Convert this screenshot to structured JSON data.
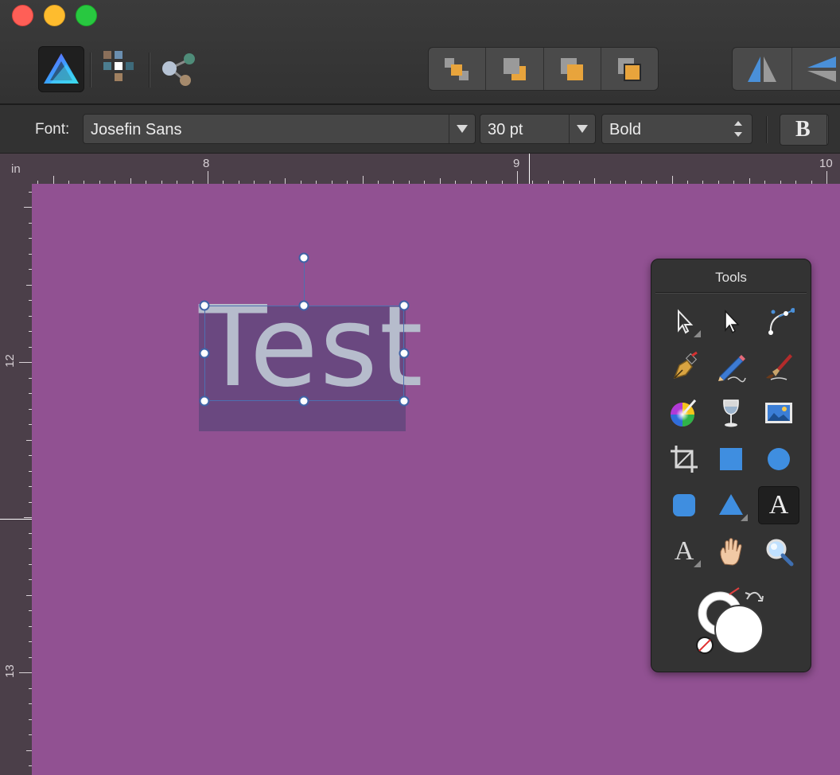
{
  "window": {
    "controls": [
      "close",
      "minimize",
      "zoom"
    ]
  },
  "toolbar": {
    "personas": [
      {
        "name": "photo-persona",
        "icon": "affinity-photo-icon",
        "active": true
      },
      {
        "name": "develop-persona",
        "icon": "develop-grid-icon",
        "active": false
      },
      {
        "name": "export-persona",
        "icon": "export-nodes-icon",
        "active": false
      }
    ],
    "arrange_buttons": [
      "move-to-back-icon",
      "move-back-one-icon",
      "move-forward-one-icon",
      "move-to-front-icon"
    ],
    "flip_buttons": [
      "flip-horizontal-icon",
      "flip-vertical-icon"
    ]
  },
  "context": {
    "font_label": "Font:",
    "font_family": "Josefin Sans",
    "font_size": "30 pt",
    "font_weight": "Bold",
    "bold_label": "B"
  },
  "ruler": {
    "unit": "in",
    "horizontal": [
      "8",
      "9",
      "10"
    ],
    "vertical": [
      "12",
      "13"
    ]
  },
  "canvas": {
    "text": "Test",
    "colors": {
      "background": "#915192",
      "text": "#b6bccc",
      "selection": "#4e6fb0"
    }
  },
  "tools": {
    "title": "Tools",
    "items": [
      "move-tool-icon",
      "node-tool-icon",
      "vector-crop-icon",
      "pen-tool-icon",
      "pencil-tool-icon",
      "vector-brush-icon",
      "fill-tool-icon",
      "transparency-tool-icon",
      "place-image-icon",
      "crop-tool-icon",
      "rectangle-tool-icon",
      "ellipse-tool-icon",
      "rounded-rectangle-icon",
      "triangle-tool-icon",
      "artistic-text-icon",
      "frame-text-icon",
      "view-tool-icon",
      "zoom-tool-icon"
    ],
    "active_tool": "artistic-text-icon",
    "fill_color": "#ffffff",
    "stroke_color": "#ffffff"
  }
}
